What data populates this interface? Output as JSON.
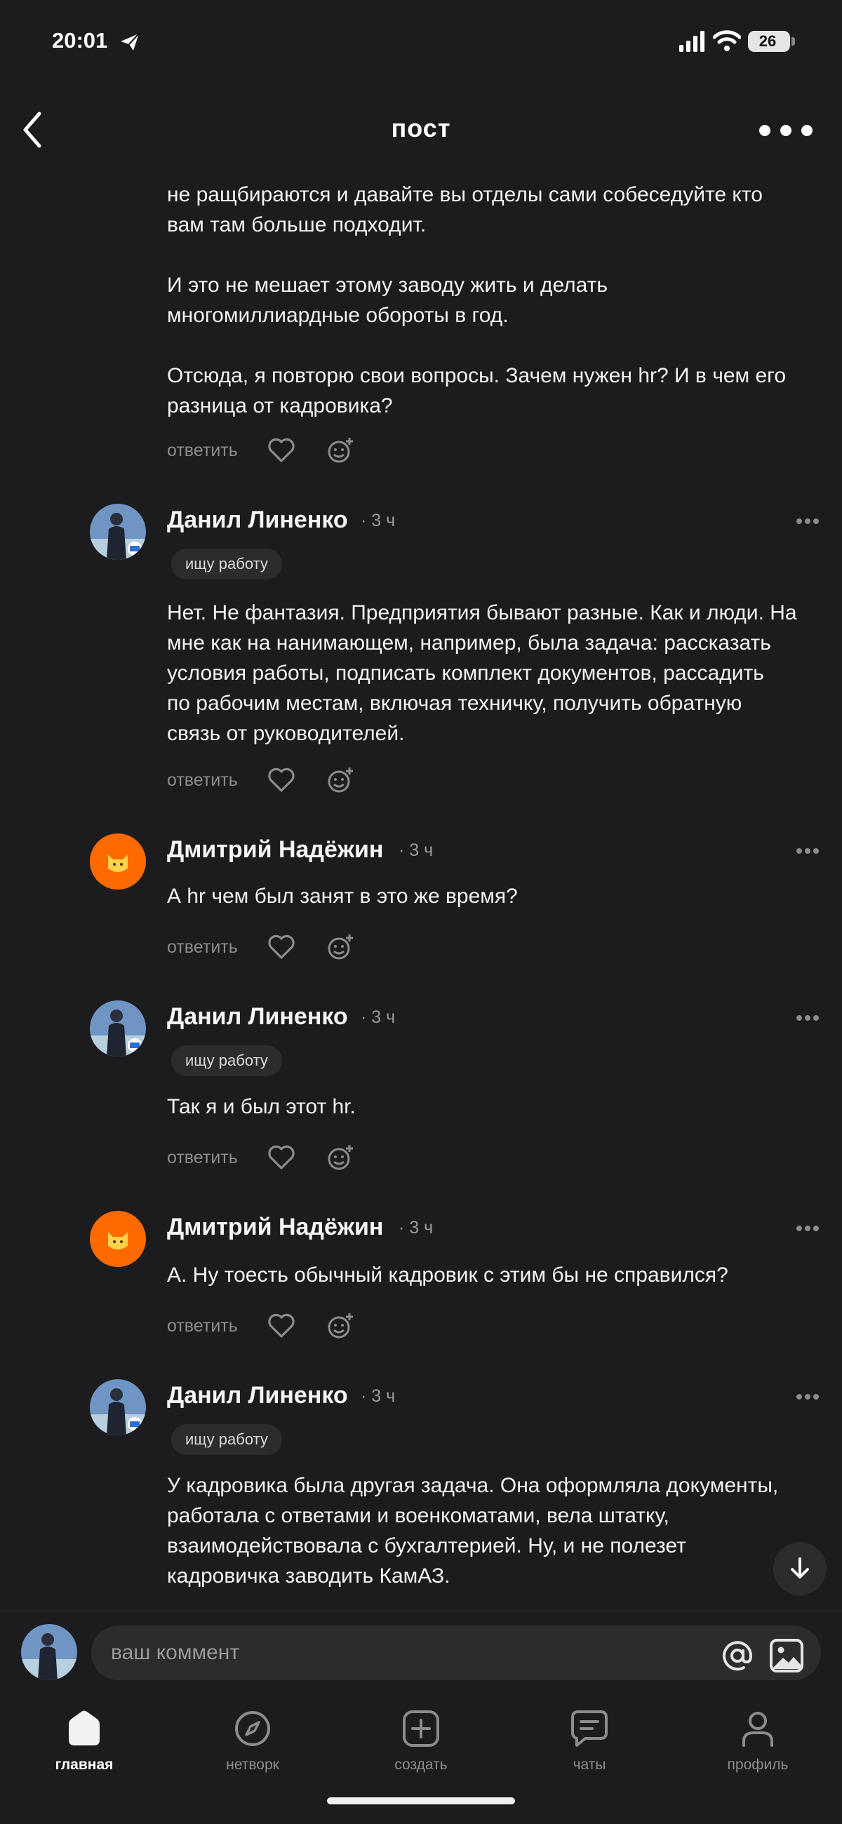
{
  "status_bar": {
    "time": "20:01",
    "battery": "26"
  },
  "header": {
    "title": "пост"
  },
  "comments": [
    {
      "text": "не ращбираются и давайте вы отделы сами собеседуйте кто\nвам там больше подходит.\n\nИ это не мешает этому заводу жить и делать\nмногомиллиардные обороты в год.\n\nОтсюда, я повторю свои вопросы. Зачем нужен hr? И в чем его\nразница от кадровика?",
      "reply_label": "ответить"
    },
    {
      "author": "Данил Линенко",
      "time": "· 3 ч",
      "badge": "ищу работу",
      "text": "Нет. Не фантазия. Предприятия бывают разные. Как и люди. На\nмне как на нанимающем, например, была задача: рассказать\nусловия работы, подписать комплект документов, рассадить\nпо рабочим местам, включая техничку, получить обратную\nсвязь от руководителей.",
      "reply_label": "ответить"
    },
    {
      "author": "Дмитрий Надёжин",
      "time": "· 3 ч",
      "text": "А hr чем был занят в это же время?",
      "reply_label": "ответить"
    },
    {
      "author": "Данил Линенко",
      "time": "· 3 ч",
      "badge": "ищу работу",
      "text": "Так я и был этот hr.",
      "reply_label": "ответить"
    },
    {
      "author": "Дмитрий Надёжин",
      "time": "· 3 ч",
      "text": "А. Ну тоесть обычный кадровик с этим бы не справился?",
      "reply_label": "ответить"
    },
    {
      "author": "Данил Линенко",
      "time": "· 3 ч",
      "badge": "ищу работу",
      "text": "У кадровика была другая задача. Она оформляла документы,\nработала с ответами и военкоматами, вела штатку,\nвзаимодействовала с бухгалтерией. Ну, и не полезет\nкадровичка заводить КамАЗ."
    }
  ],
  "composer": {
    "placeholder": "ваш коммент"
  },
  "tabbar": {
    "items": [
      {
        "label": "главная",
        "icon": "home-icon",
        "active": true
      },
      {
        "label": "нетворк",
        "icon": "compass-icon"
      },
      {
        "label": "создать",
        "icon": "plus-square-icon"
      },
      {
        "label": "чаты",
        "icon": "chat-icon"
      },
      {
        "label": "профиль",
        "icon": "person-icon"
      }
    ]
  },
  "colors": {
    "background": "#1c1c1e",
    "surface": "#2c2c2e",
    "muted": "#8c8c8e",
    "cat_avatar": "#ff6a00"
  }
}
